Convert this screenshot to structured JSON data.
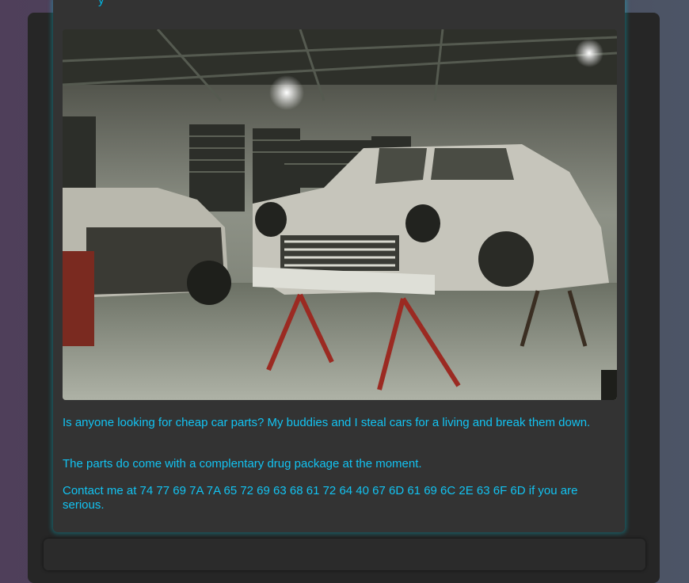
{
  "post": {
    "paragraphs": [
      "Is anyone looking for cheap car parts? My buddies and I steal cars for a living and break them down.",
      "The parts do come with a complentary drug package at the moment.",
      "Contact me at 74 77 69 7A 7A 65 72 69 63 68 61 72 64 40 67 6D 61 69 6C 2E 63 6F 6D if you are serious."
    ]
  },
  "colors": {
    "text": "#12c3f2",
    "card_background": "#333333",
    "panel_background": "#262626",
    "glow": "#00c8dc"
  }
}
